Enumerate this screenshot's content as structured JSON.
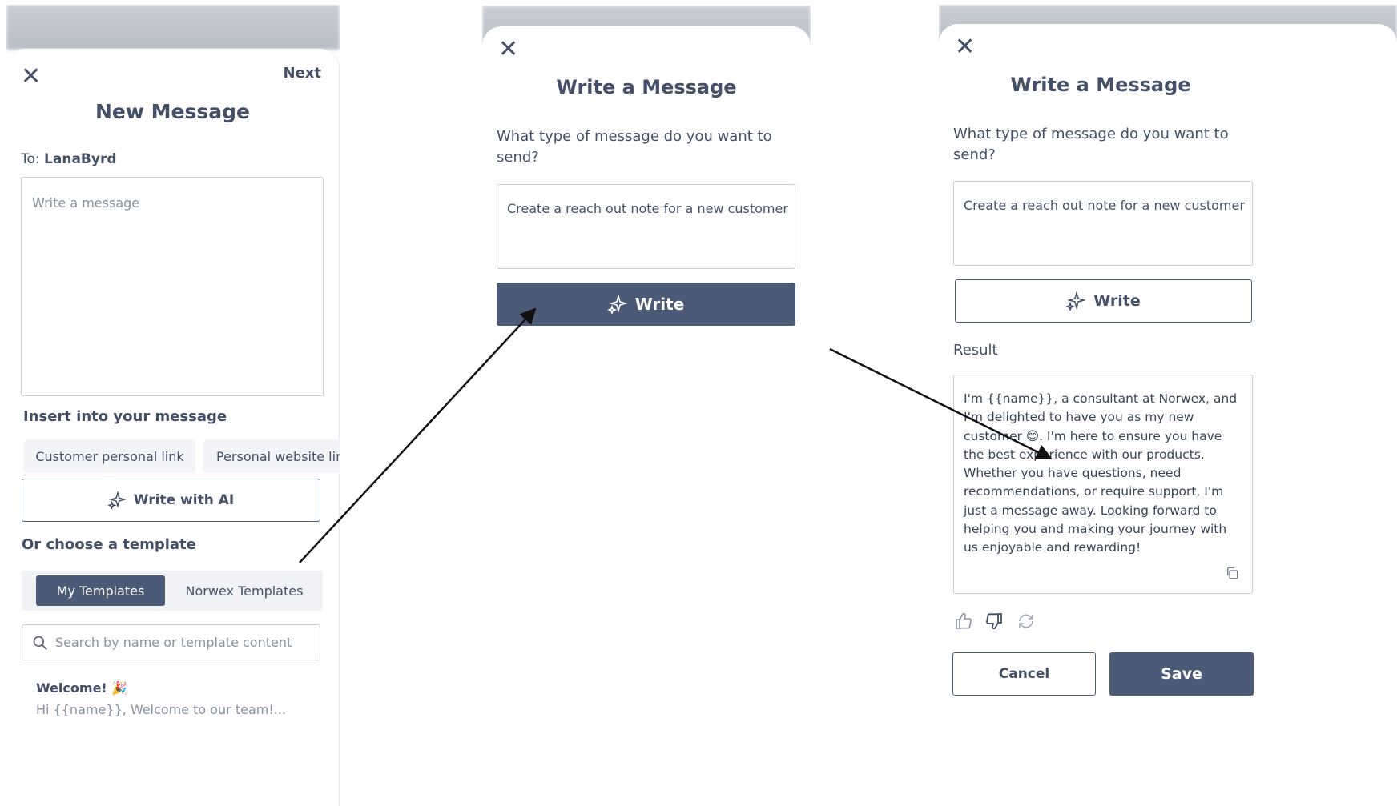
{
  "panel1": {
    "close_icon": "close-icon",
    "next_label": "Next",
    "title": "New Message",
    "to_prefix": "To:",
    "to_name": "LanaByrd",
    "message_placeholder": "Write a message",
    "insert_heading": "Insert into your message",
    "chips": [
      "Customer personal link",
      "Personal website lin"
    ],
    "write_ai_label": "Write with AI",
    "template_heading": "Or choose a template",
    "tabs": [
      "My Templates",
      "Norwex Templates"
    ],
    "search_placeholder": "Search by name or template content",
    "template_item": {
      "title": "Welcome! 🎉",
      "preview": "Hi {{name}}, Welcome to our team!..."
    }
  },
  "panel2": {
    "title": "Write a Message",
    "question": "What type of message do you want to send?",
    "prompt_value": "Create a reach out note for a new customer",
    "write_label": "Write"
  },
  "panel3": {
    "title": "Write a Message",
    "question": "What type of message do you want to send?",
    "prompt_value": "Create a reach out note for a new customer",
    "write_label": "Write",
    "result_label": "Result",
    "result_text": "I'm {{name}}, a consultant at Norwex, and I'm delighted to have you as my new customer 😊. I'm here to ensure you have the best experience with our products. Whether you have questions, need recommendations, or require support, I'm just a message away. Looking forward to helping you and making your journey with us enjoyable and rewarding!",
    "cancel_label": "Cancel",
    "save_label": "Save"
  },
  "colors": {
    "primary": "#4b5a76",
    "text": "#44506a",
    "border": "#c9ced6"
  }
}
